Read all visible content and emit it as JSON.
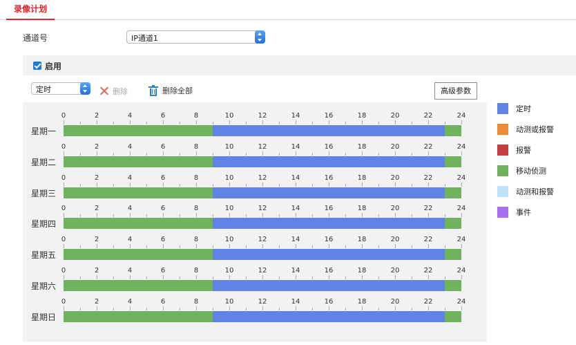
{
  "tab": {
    "label": "录像计划"
  },
  "channel": {
    "label": "通道号",
    "value": "IP通道1"
  },
  "enable": {
    "label": "启用",
    "checked": true
  },
  "toolbar": {
    "mode_value": "定时",
    "delete_label": "删除",
    "delete_all_label": "删除全部",
    "advanced_label": "高级参数"
  },
  "hours": [
    "0",
    "2",
    "4",
    "6",
    "8",
    "10",
    "12",
    "14",
    "16",
    "18",
    "20",
    "22",
    "24"
  ],
  "colors": {
    "定时": "#6382e6",
    "动测或报警": "#ee8a31",
    "报警": "#c53e3e",
    "移动侦测": "#6fb35f",
    "动测和报警": "#bce2f8",
    "事件": "#a86ef0"
  },
  "legend": [
    {
      "label": "定时",
      "color": "#6382e6"
    },
    {
      "label": "动测或报警",
      "color": "#ee8a31"
    },
    {
      "label": "报警",
      "color": "#c53e3e"
    },
    {
      "label": "移动侦测",
      "color": "#6fb35f"
    },
    {
      "label": "动测和报警",
      "color": "#bce2f8"
    },
    {
      "label": "事件",
      "color": "#a86ef0"
    }
  ],
  "schedule": [
    {
      "day": "星期一",
      "segments": [
        {
          "start": 0,
          "end": 9,
          "type": "移动侦测"
        },
        {
          "start": 9,
          "end": 23,
          "type": "定时"
        },
        {
          "start": 23,
          "end": 24,
          "type": "移动侦测"
        }
      ]
    },
    {
      "day": "星期二",
      "segments": [
        {
          "start": 0,
          "end": 9,
          "type": "移动侦测"
        },
        {
          "start": 9,
          "end": 23,
          "type": "定时"
        },
        {
          "start": 23,
          "end": 24,
          "type": "移动侦测"
        }
      ]
    },
    {
      "day": "星期三",
      "segments": [
        {
          "start": 0,
          "end": 9,
          "type": "移动侦测"
        },
        {
          "start": 9,
          "end": 23,
          "type": "定时"
        },
        {
          "start": 23,
          "end": 24,
          "type": "移动侦测"
        }
      ]
    },
    {
      "day": "星期四",
      "segments": [
        {
          "start": 0,
          "end": 9,
          "type": "移动侦测"
        },
        {
          "start": 9,
          "end": 23,
          "type": "定时"
        },
        {
          "start": 23,
          "end": 24,
          "type": "移动侦测"
        }
      ]
    },
    {
      "day": "星期五",
      "segments": [
        {
          "start": 0,
          "end": 9,
          "type": "移动侦测"
        },
        {
          "start": 9,
          "end": 23,
          "type": "定时"
        },
        {
          "start": 23,
          "end": 24,
          "type": "移动侦测"
        }
      ]
    },
    {
      "day": "星期六",
      "segments": [
        {
          "start": 0,
          "end": 9,
          "type": "移动侦测"
        },
        {
          "start": 9,
          "end": 23,
          "type": "定时"
        },
        {
          "start": 23,
          "end": 24,
          "type": "移动侦测"
        }
      ]
    },
    {
      "day": "星期日",
      "segments": [
        {
          "start": 0,
          "end": 9,
          "type": "移动侦测"
        },
        {
          "start": 9,
          "end": 23,
          "type": "定时"
        },
        {
          "start": 23,
          "end": 24,
          "type": "移动侦测"
        }
      ]
    }
  ]
}
